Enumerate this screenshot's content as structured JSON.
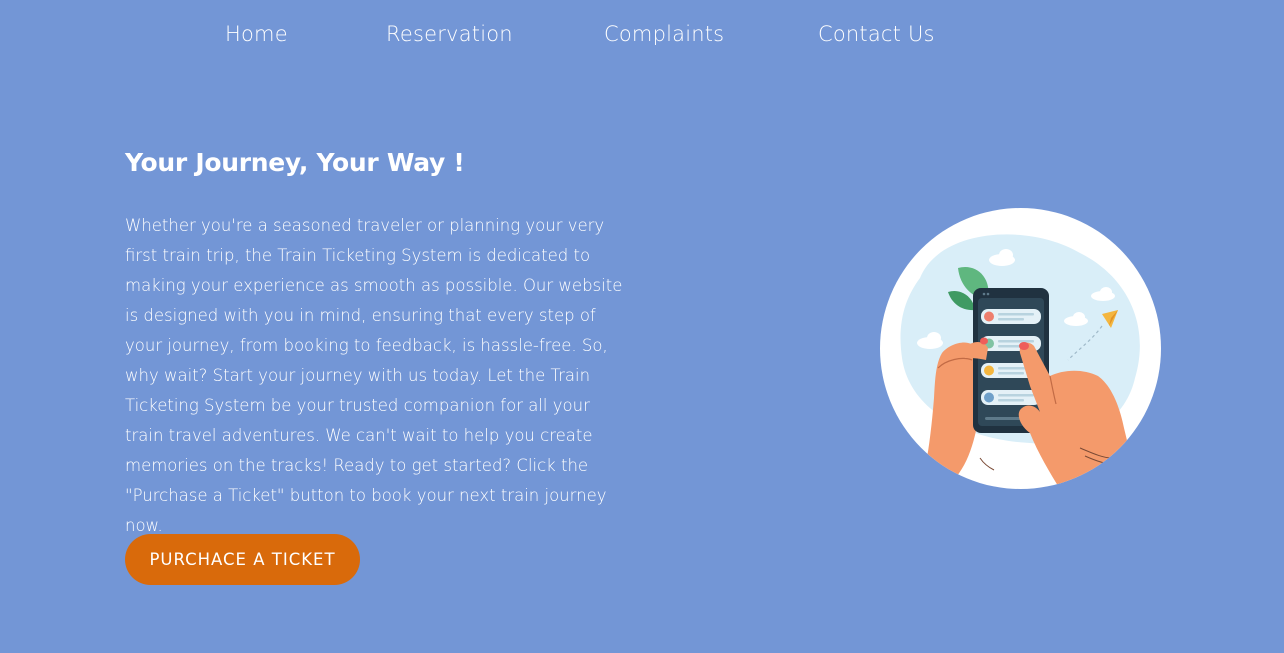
{
  "nav": {
    "items": [
      {
        "label": "Home"
      },
      {
        "label": "Reservation"
      },
      {
        "label": "Complaints"
      },
      {
        "label": "Contact Us"
      }
    ]
  },
  "hero": {
    "title": "Your Journey, Your Way !",
    "body": "Whether you're a seasoned traveler or planning your very first train trip, the Train Ticketing System is dedicated to making your experience as smooth as possible. Our website is designed with you in mind, ensuring that every step of your journey, from booking to feedback, is hassle-free. So, why wait? Start your journey with us today. Let the Train Ticketing System be your trusted companion for all your train travel adventures. We can't wait to help you create memories on the tracks! Ready to get started? Click the \"Purchase a Ticket\" button to book your next train journey now.",
    "cta_label": "PURCHACE A TICKET"
  },
  "illustration": {
    "icon": "phone-booking-illustration"
  },
  "colors": {
    "background": "#7396d6",
    "cta": "#d96a0b",
    "text": "#ffffff"
  }
}
